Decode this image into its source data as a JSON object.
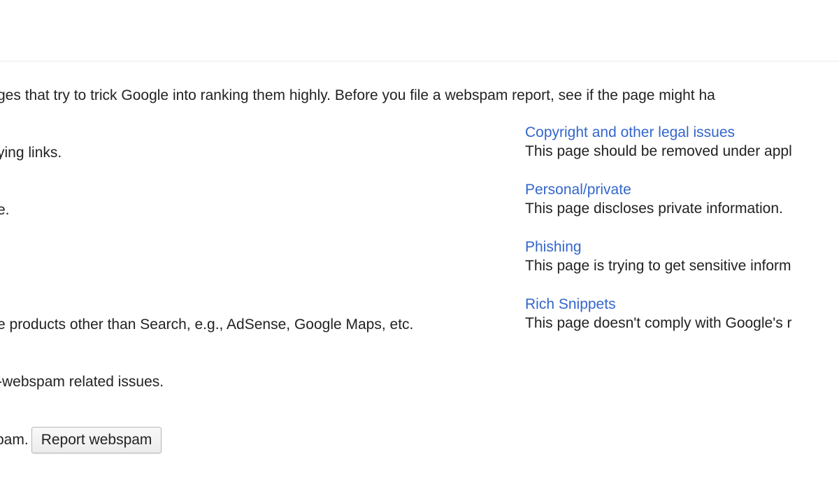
{
  "intro": {
    "text": "ges that try to trick Google into ranking them highly. Before you file a webspam report, see if the page might ha"
  },
  "left_column": {
    "buying_links": "ying links.",
    "line_two": "e.",
    "other_products": "e products other than Search, e.g., AdSense, Google Maps, etc.",
    "non_webspam": "-webspam related issues.",
    "spam_prefix": "pam."
  },
  "options": [
    {
      "title": "Copyright and other legal issues",
      "description": "This page should be removed under appl"
    },
    {
      "title": "Personal/private",
      "description": "This page discloses private information."
    },
    {
      "title": "Phishing",
      "description": "This page is trying to get sensitive inform"
    },
    {
      "title": "Rich Snippets",
      "description": "This page doesn't comply with Google's r"
    }
  ],
  "actions": {
    "report_button_label": "Report webspam"
  },
  "colors": {
    "link": "#3366cc",
    "text": "#222222",
    "divider": "#ebebeb"
  }
}
